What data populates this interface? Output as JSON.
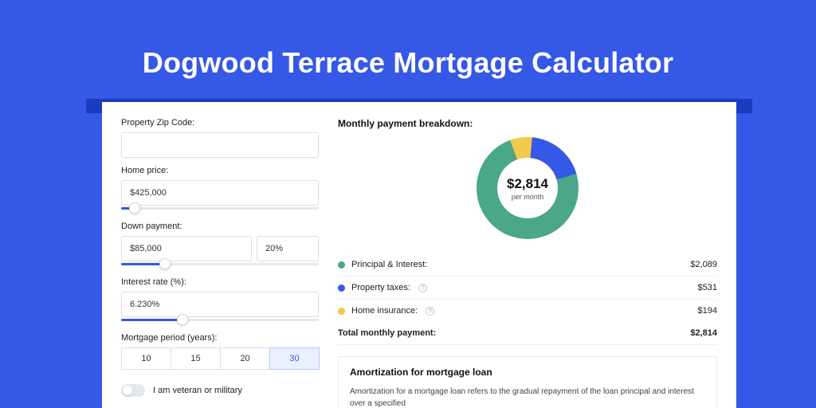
{
  "page": {
    "title": "Dogwood Terrace Mortgage Calculator"
  },
  "form": {
    "zip_label": "Property Zip Code:",
    "zip_value": "",
    "home_price_label": "Home price:",
    "home_price_value": "$425,000",
    "home_price_slider_pct": 7,
    "down_payment_label": "Down payment:",
    "down_payment_value": "$85,000",
    "down_payment_pct_value": "20%",
    "down_payment_slider_pct": 22,
    "interest_label": "Interest rate (%):",
    "interest_value": "6.230%",
    "interest_slider_pct": 31,
    "period_label": "Mortgage period (years):",
    "period_options": [
      "10",
      "15",
      "20",
      "30"
    ],
    "period_selected": "30",
    "veteran_label": "I am veteran or military",
    "veteran_on": false
  },
  "breakdown": {
    "title": "Monthly payment breakdown:",
    "center_amount": "$2,814",
    "center_sub": "per month",
    "items": [
      {
        "label": "Principal & Interest:",
        "value": "$2,089",
        "color": "#4aa789",
        "has_info": false,
        "share": 74
      },
      {
        "label": "Property taxes:",
        "value": "$531",
        "color": "#3558e6",
        "has_info": true,
        "share": 19
      },
      {
        "label": "Home insurance:",
        "value": "$194",
        "color": "#f2c94c",
        "has_info": true,
        "share": 7
      }
    ],
    "total_label": "Total monthly payment:",
    "total_value": "$2,814"
  },
  "amortization": {
    "title": "Amortization for mortgage loan",
    "text": "Amortization for a mortgage loan refers to the gradual repayment of the loan principal and interest over a specified"
  },
  "chart_data": {
    "type": "pie",
    "title": "Monthly payment breakdown",
    "series": [
      {
        "name": "Principal & Interest",
        "value": 2089,
        "color": "#4aa789"
      },
      {
        "name": "Property taxes",
        "value": 531,
        "color": "#3558e6"
      },
      {
        "name": "Home insurance",
        "value": 194,
        "color": "#f2c94c"
      }
    ],
    "total": 2814,
    "center_label": "$2,814 per month"
  }
}
